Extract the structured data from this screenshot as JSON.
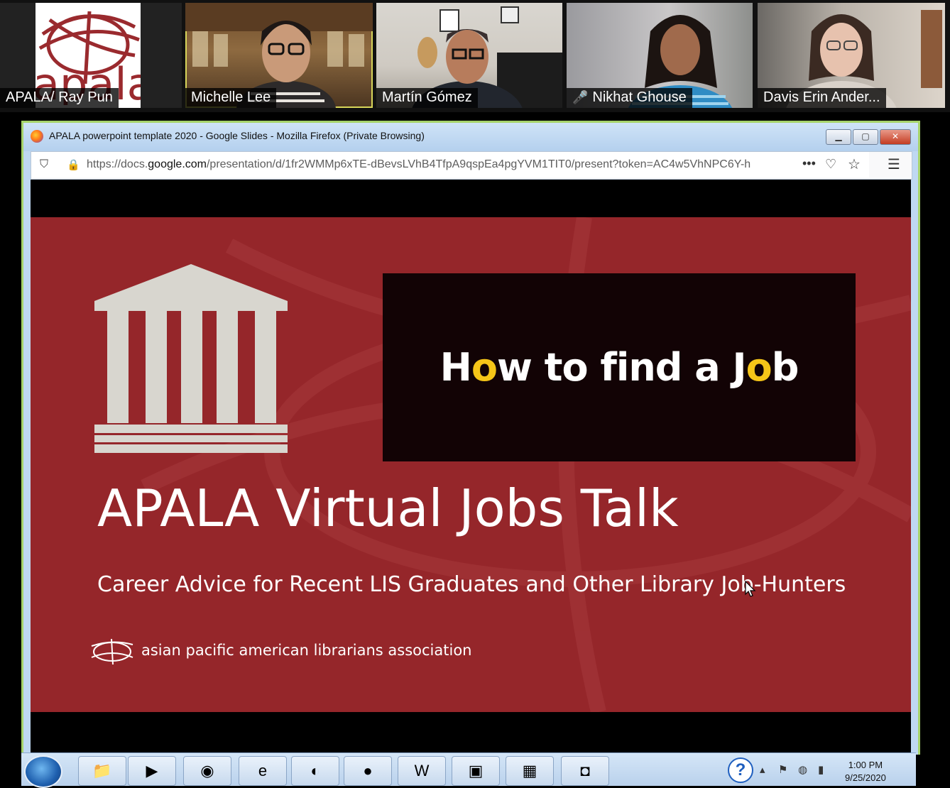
{
  "participants": [
    {
      "name": "APALA/ Ray Pun",
      "logo_text": "apala",
      "muted": false
    },
    {
      "name": "Michelle Lee",
      "muted": false,
      "active_speaker": true
    },
    {
      "name": "Martín Gómez",
      "muted": false
    },
    {
      "name": "Nikhat Ghouse",
      "muted": true
    },
    {
      "name": "Davis Erin Ander...",
      "muted": false
    }
  ],
  "browser": {
    "window_title": "APALA powerpoint template 2020 - Google Slides - Mozilla Firefox (Private Browsing)",
    "url_prefix": "https://docs.",
    "url_domain": "google.com",
    "url_path": "/presentation/d/1fr2WMMp6xTE-dBevsLVhB4TfpA9qspEa4pgYVM1TIT0/present?token=AC4w5VhNPC6Y-h",
    "page_actions_label": "•••",
    "window_buttons": {
      "minimize": "▁",
      "maximize": "▢",
      "close": "✕"
    }
  },
  "slide": {
    "banner": {
      "part1": "H",
      "o_glyph": "o",
      "part2": "w to find a J",
      "gear_glyph": "o",
      "part3": "b"
    },
    "title": "APALA Virtual Jobs Talk",
    "subtitle": "Career Advice for Recent LIS Graduates and Other Library Job-Hunters",
    "org_name": "asian pacific american librarians association"
  },
  "taskbar": {
    "apps": [
      "explorer-icon",
      "media-player-icon",
      "chrome-icon",
      "internet-explorer-icon",
      "edge-icon",
      "firefox-icon",
      "word-icon",
      "photos-icon",
      "control-panel-icon",
      "zoom-icon"
    ],
    "time": "1:00 PM",
    "date": "9/25/2020",
    "help_label": "?"
  },
  "colors": {
    "slide_red": "#95262a",
    "accent_yellow": "#f5c518",
    "active_border": "#d7d55a",
    "window_frame": "#a7d46b"
  }
}
